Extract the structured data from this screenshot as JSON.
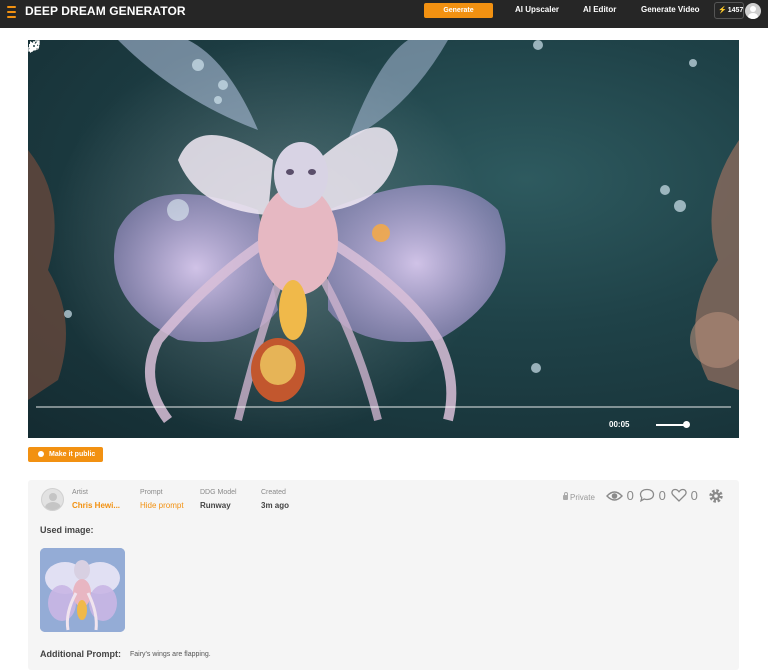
{
  "header": {
    "brand": "DEEP DREAM GENERATOR",
    "generate_label": "Generate",
    "nav": [
      "AI Upscaler",
      "AI Editor",
      "Generate Video"
    ],
    "credits": "1457"
  },
  "video": {
    "current_time": "00:05",
    "volume_level": 0.9,
    "progress": 0
  },
  "actions": {
    "make_public_label": "Make it public"
  },
  "info": {
    "artist_label": "Artist",
    "artist_name": "Chris Hewi...",
    "prompt_label": "Prompt",
    "prompt_link": "Hide prompt",
    "model_label": "DDG Model",
    "model_value": "Runway",
    "created_label": "Created",
    "created_value": "3m ago",
    "visibility": "Private",
    "views": "0",
    "comments": "0",
    "likes": "0",
    "used_image_label": "Used image:",
    "additional_prompt_label": "Additional Prompt:",
    "additional_prompt_text": "Fairy's wings are flapping."
  },
  "colors": {
    "accent": "#f29111",
    "topbar": "#262626",
    "panel": "#f5f5f5"
  },
  "icons": [
    "menu-logo-icon",
    "bolt-icon",
    "user-avatar-icon",
    "play-icon",
    "volume-icon",
    "settings-gear-icon",
    "fullscreen-icon",
    "globe-icon",
    "lock-icon",
    "eye-icon",
    "comment-icon",
    "heart-icon",
    "gear-icon"
  ]
}
